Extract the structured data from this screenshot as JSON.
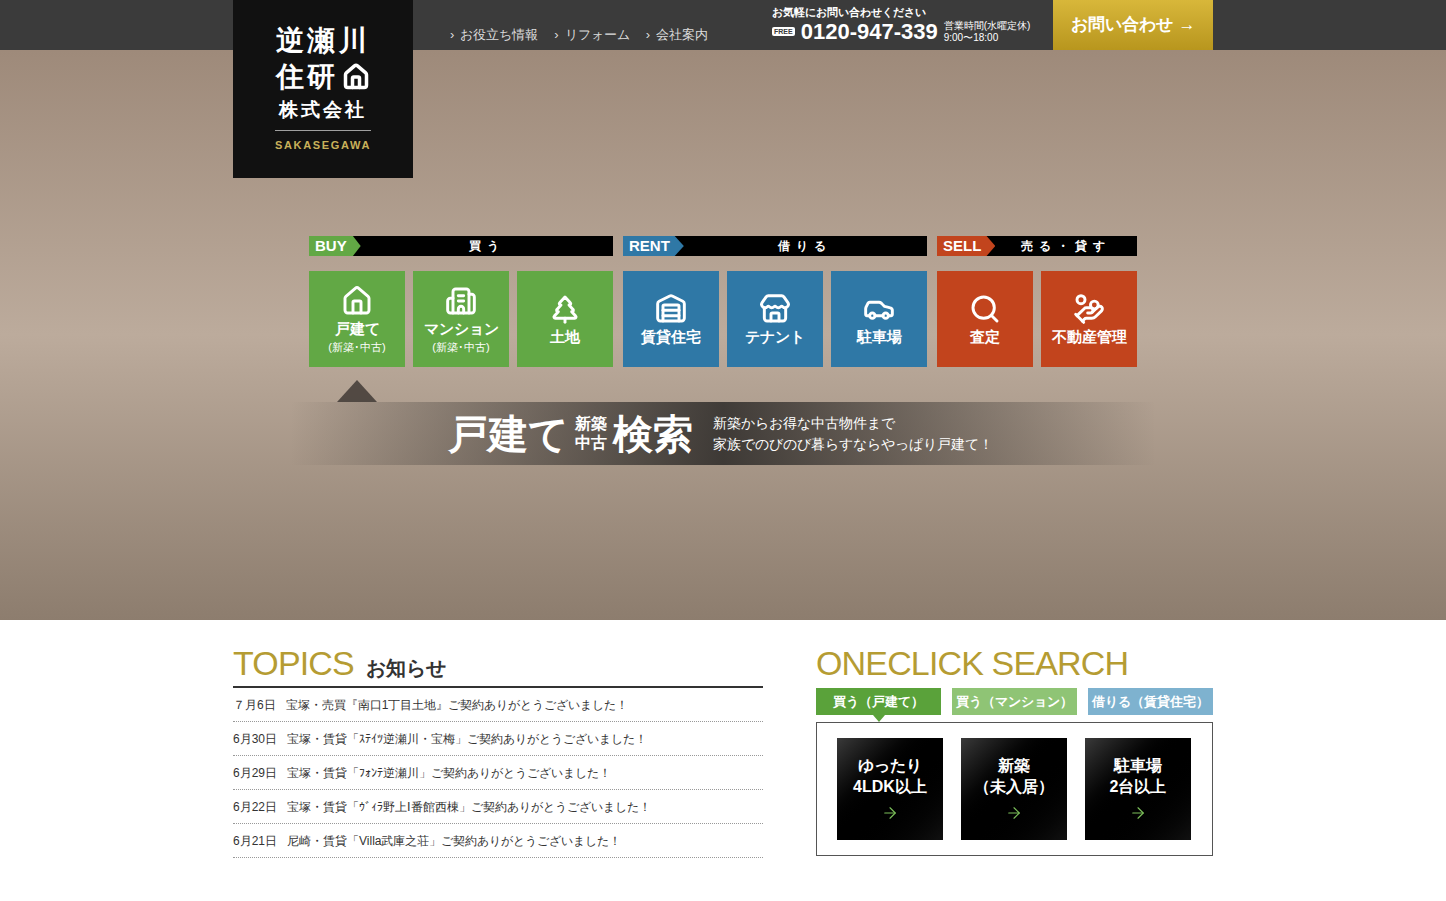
{
  "header": {
    "logo": {
      "lines": [
        "逆瀬川",
        "住研",
        "株式会社"
      ],
      "romaji": "SAKASEGAWA"
    },
    "nav": [
      {
        "marker": "›",
        "label": "お役立ち情報"
      },
      {
        "marker": "›",
        "label": "リフォーム"
      },
      {
        "marker": "›",
        "label": "会社案内"
      }
    ],
    "phone": {
      "caption": "お気軽にお問い合わせください",
      "badge": "FREE",
      "number": "0120-947-339",
      "hours_label": "営業時間(水曜定休)",
      "hours": "9:00〜18:00"
    },
    "contact_button": {
      "label": "お問い合わせ",
      "arrow": "→"
    }
  },
  "hero": {
    "groups": [
      {
        "tag": "BUY",
        "title": "買う",
        "color": "#62a845",
        "items": [
          {
            "label": "戸建て",
            "sub": "(新築･中古)",
            "selected": true
          },
          {
            "label": "マンション",
            "sub": "(新築･中古)",
            "selected": false
          },
          {
            "label": "土地",
            "sub": "",
            "selected": false
          }
        ]
      },
      {
        "tag": "RENT",
        "title": "借りる",
        "color": "#2f78a6",
        "items": [
          {
            "label": "賃貸住宅",
            "sub": "",
            "selected": false
          },
          {
            "label": "テナント",
            "sub": "",
            "selected": false
          },
          {
            "label": "駐車場",
            "sub": "",
            "selected": false
          }
        ]
      },
      {
        "tag": "SELL",
        "title": "売る・貸す",
        "color": "#c2441d",
        "items": [
          {
            "label": "査定",
            "sub": "",
            "selected": false
          },
          {
            "label": "不動産管理",
            "sub": "",
            "selected": false
          }
        ]
      }
    ],
    "banner": {
      "title": "戸建て",
      "stack": [
        "新築",
        "中古"
      ],
      "suffix": "検索",
      "lines": [
        "新築からお得な中古物件まで",
        "家族でのびのび暮らすならやっぱり戸建て！"
      ]
    }
  },
  "topics": {
    "title": "TOPICS",
    "subtitle": "お知らせ",
    "items": [
      {
        "date": "７月6日",
        "text": "宝塚・売買『南口1丁目土地』ご契約ありがとうございました！"
      },
      {
        "date": "6月30日",
        "text": "宝塚・賃貸「ｽﾃｲﾂ逆瀬川・宝梅」ご契約ありがとうございました！"
      },
      {
        "date": "6月29日",
        "text": "宝塚・賃貸「ﾌｫﾝﾃ逆瀬川」ご契約ありがとうございました！"
      },
      {
        "date": "6月22日",
        "text": "宝塚・賃貸「ｳﾞｨﾗ野上Ⅰ番館西棟」ご契約ありがとうございました！"
      },
      {
        "date": "6月21日",
        "text": "尼崎・賃貸「Villa武庫之荘」ご契約ありがとうございました！"
      }
    ]
  },
  "oneclick": {
    "title": "ONECLICK SEARCH",
    "tabs": [
      {
        "label": "買う（戸建て）",
        "selected": true,
        "color": "#5aa23a"
      },
      {
        "label": "買う（マンション）",
        "selected": false,
        "color": "#8fc475"
      },
      {
        "label": "借りる（賃貸住宅）",
        "selected": false,
        "color": "#7eb2cf"
      }
    ],
    "cards": [
      {
        "lines": [
          "ゆったり",
          "4LDK以上"
        ]
      },
      {
        "lines": [
          "新築",
          "（未入居）"
        ]
      },
      {
        "lines": [
          "駐車場",
          "2台以上"
        ]
      }
    ]
  }
}
